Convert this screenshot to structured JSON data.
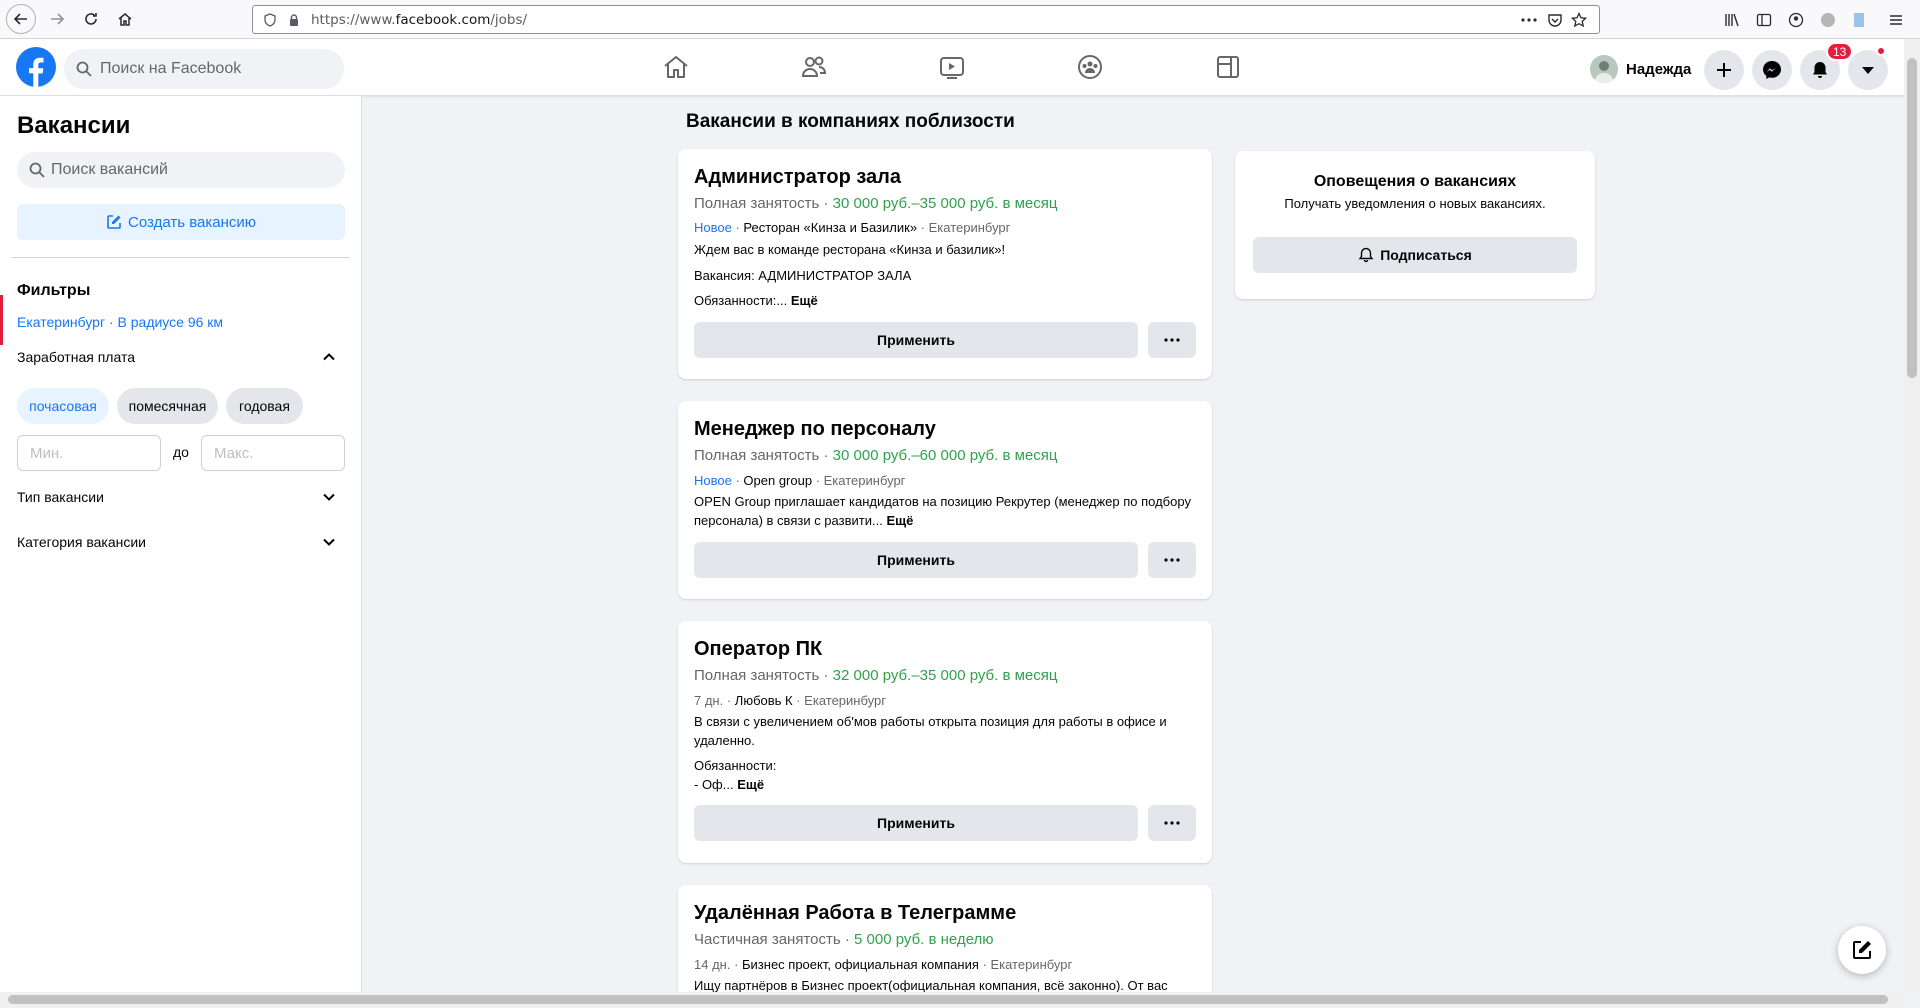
{
  "browser": {
    "url_prefix": "https://www.",
    "url_domain": "facebook.com",
    "url_path": "/jobs/"
  },
  "header": {
    "search_placeholder": "Поиск на Facebook",
    "user_name": "Надежда",
    "notification_count": "13",
    "nav_icons": [
      "home-icon",
      "friends-icon",
      "watch-icon",
      "groups-icon",
      "gaming-icon"
    ]
  },
  "sidebar": {
    "title": "Вакансии",
    "search_placeholder": "Поиск вакансий",
    "create_label": "Создать вакансию",
    "filters_title": "Фильтры",
    "location_filter": "Екатеринбург · В радиусе 96 км",
    "salary_label": "Заработная плата",
    "pay_options": [
      "почасовая",
      "помесячная",
      "годовая"
    ],
    "selected_pay_option": "почасовая",
    "min_placeholder": "Мин.",
    "range_sep": "до",
    "max_placeholder": "Макс.",
    "job_type_label": "Тип вакансии",
    "category_label": "Категория вакансии"
  },
  "feed": {
    "title": "Вакансии в компаниях поблизости",
    "apply_label": "Применить",
    "more_label": "Ещё",
    "jobs": [
      {
        "title": "Администратор зала",
        "employment": "Полная занятость",
        "pay": "30 000 руб.–35 000 руб. в месяц",
        "age": "Новое",
        "company": "Ресторан «Кинза и Базилик»",
        "city": "Екатеринбург",
        "desc1": "Ждем вас в команде ресторана «Кинза и базилик»!",
        "desc2": "Вакансия: АДМИНИСТРАТОР ЗАЛА",
        "desc3": "Обязанности:..."
      },
      {
        "title": "Менеджер по персоналу",
        "employment": "Полная занятость",
        "pay": "30 000 руб.–60 000 руб. в месяц",
        "age": "Новое",
        "company": "Open group",
        "city": "Екатеринбург",
        "desc1": "OPEN Group приглашает кандидатов на позицию Рекрутер (менеджер по подбору персонала) в связи с развити..."
      },
      {
        "title": "Оператор ПК",
        "employment": "Полная занятость",
        "pay": "32 000 руб.–35 000 руб. в месяц",
        "age": "7 дн.",
        "company": "Любовь К",
        "city": "Екатеринбург",
        "desc1": "В связи с увеличением об'мов работы открыта позиция для работы в офисе и удаленно.",
        "desc2": "Обязанности:",
        "desc3": "- Оф..."
      },
      {
        "title": "Удалённая Работа в Телеграмме",
        "employment": "Частичная занятость",
        "pay": "5 000 руб. в неделю",
        "age": "14 дн.",
        "company": "Бизнес проект, официальная компания",
        "city": "Екатеринбург",
        "desc1": "Ищу партнёров в Бизнес проект(официальная компания, всё законно). От вас"
      }
    ]
  },
  "alerts": {
    "title": "Оповещения о вакансиях",
    "subtitle": "Получать уведомления о новых вакансиях.",
    "subscribe_label": "Подписаться"
  },
  "colors": {
    "brand": "#1877f2",
    "pay_green": "#31a24c",
    "badge_red": "#e41e3f"
  }
}
